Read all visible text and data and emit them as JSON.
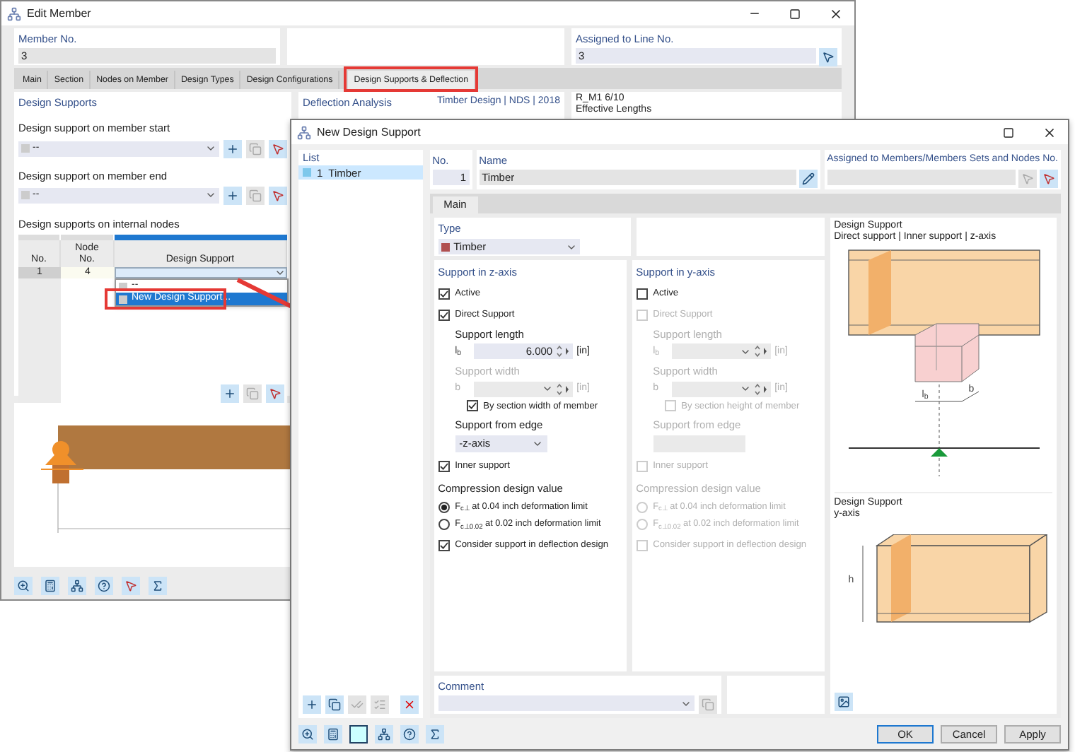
{
  "edit_member": {
    "title": "Edit Member",
    "member_no": {
      "label": "Member No.",
      "value": "3"
    },
    "assigned_line": {
      "label": "Assigned to Line No.",
      "value": "3"
    },
    "tabs": [
      {
        "label": "Main",
        "selected": false
      },
      {
        "label": "Section",
        "selected": false
      },
      {
        "label": "Nodes on Member",
        "selected": false
      },
      {
        "label": "Design Types",
        "selected": false
      },
      {
        "label": "Design Configurations",
        "selected": false
      },
      {
        "label": "Design Supports & Deflection",
        "selected": true
      }
    ],
    "design_supports": {
      "title": "Design Supports",
      "start": {
        "label": "Design support on member start",
        "value": "--"
      },
      "end": {
        "label": "Design support on member end",
        "value": "--"
      },
      "internal_label": "Design supports on internal nodes",
      "table": {
        "columns": [
          "No.",
          "Node No.",
          "Design Support"
        ],
        "rows": [
          {
            "cells": [
              "1",
              "4"
            ]
          }
        ]
      },
      "dropdown": [
        {
          "label": "--",
          "selected": false
        },
        {
          "label": "New Design Support...",
          "selected": true
        }
      ]
    },
    "deflection_title": "Deflection Analysis",
    "design_info": "Timber Design | NDS | 2018",
    "right_info": [
      "R_M1 6/10",
      "Effective Lengths"
    ]
  },
  "new_design_support": {
    "title": "New Design Support",
    "list": {
      "title": "List",
      "items": [
        {
          "no": "1",
          "name": "Timber",
          "selected": true
        }
      ]
    },
    "no": {
      "label": "No.",
      "value": "1"
    },
    "name": {
      "label": "Name",
      "value": "Timber"
    },
    "assigned": {
      "label": "Assigned to Members/Members Sets and Nodes No."
    },
    "tabs": [
      {
        "label": "Main",
        "selected": true
      }
    ],
    "type": {
      "label": "Type",
      "value": "Timber",
      "color": "#b05050"
    },
    "z_axis": {
      "title": "Support in z-axis",
      "items": [
        {
          "kind": "checkbox",
          "label": "Active",
          "checked": true,
          "disabled": false
        },
        {
          "kind": "checkbox",
          "label": "Direct Support",
          "checked": true,
          "disabled": false
        },
        {
          "kind": "field",
          "label": "Support length",
          "symbol": "l$_{b}$",
          "value": "6.000",
          "unit": "[in]",
          "disabled": false
        },
        {
          "kind": "field",
          "label": "Support width",
          "symbol": "b",
          "unit": "[in]",
          "disabled": true
        },
        {
          "kind": "subcheckbox",
          "label": "By section width of member",
          "checked": true,
          "disabled": false
        },
        {
          "kind": "select",
          "label": "Support from edge",
          "value": "-z-axis",
          "disabled": false
        },
        {
          "kind": "checkbox",
          "label": "Inner support",
          "checked": true,
          "disabled": false
        },
        {
          "kind": "heading",
          "label": "Compression design value",
          "disabled": false
        },
        {
          "kind": "radio",
          "label": "F$_{c⊥}$ at 0.04 inch deformation limit",
          "selected": true,
          "disabled": false
        },
        {
          "kind": "radio",
          "label": "F$_{c⊥0.02}$ at 0.02 inch deformation limit",
          "selected": false,
          "disabled": false
        },
        {
          "kind": "checkbox",
          "label": "Consider support in deflection design",
          "checked": true,
          "disabled": false
        }
      ]
    },
    "y_axis": {
      "title": "Support in y-axis",
      "items": [
        {
          "kind": "checkbox",
          "label": "Active",
          "checked": false,
          "disabled": false
        },
        {
          "kind": "checkbox",
          "label": "Direct Support",
          "checked": false,
          "disabled": true
        },
        {
          "kind": "field",
          "label": "Support length",
          "symbol": "l$_{b}$",
          "unit": "[in]",
          "disabled": true
        },
        {
          "kind": "field",
          "label": "Support width",
          "symbol": "b",
          "unit": "[in]",
          "disabled": true
        },
        {
          "kind": "subcheckbox",
          "label": "By section height of member",
          "checked": false,
          "disabled": true
        },
        {
          "kind": "select",
          "label": "Support from edge",
          "disabled": true
        },
        {
          "kind": "checkbox",
          "label": "Inner support",
          "checked": false,
          "disabled": true
        },
        {
          "kind": "heading",
          "label": "Compression design value",
          "disabled": true
        },
        {
          "kind": "radio",
          "label": "F$_{c⊥}$ at 0.04 inch deformation limit",
          "selected": false,
          "disabled": true
        },
        {
          "kind": "radio",
          "label": "F$_{c⊥0.02}$ at 0.02 inch deformation limit",
          "selected": false,
          "disabled": true
        },
        {
          "kind": "checkbox",
          "label": "Consider support in deflection design",
          "checked": false,
          "disabled": true
        }
      ]
    },
    "comment": {
      "label": "Comment"
    },
    "pictures": [
      {
        "kind": "z",
        "title": "Design Support",
        "subtitle": "Direct support | Inner support | z-axis",
        "dims": [
          "l$_{b}$",
          "b"
        ]
      },
      {
        "kind": "y",
        "title": "Design Support",
        "subtitle": "y-axis",
        "dims": [
          "h"
        ]
      }
    ],
    "buttons": [
      {
        "label": "OK",
        "default": true
      },
      {
        "label": "Cancel",
        "default": false
      },
      {
        "label": "Apply",
        "default": false
      }
    ]
  }
}
